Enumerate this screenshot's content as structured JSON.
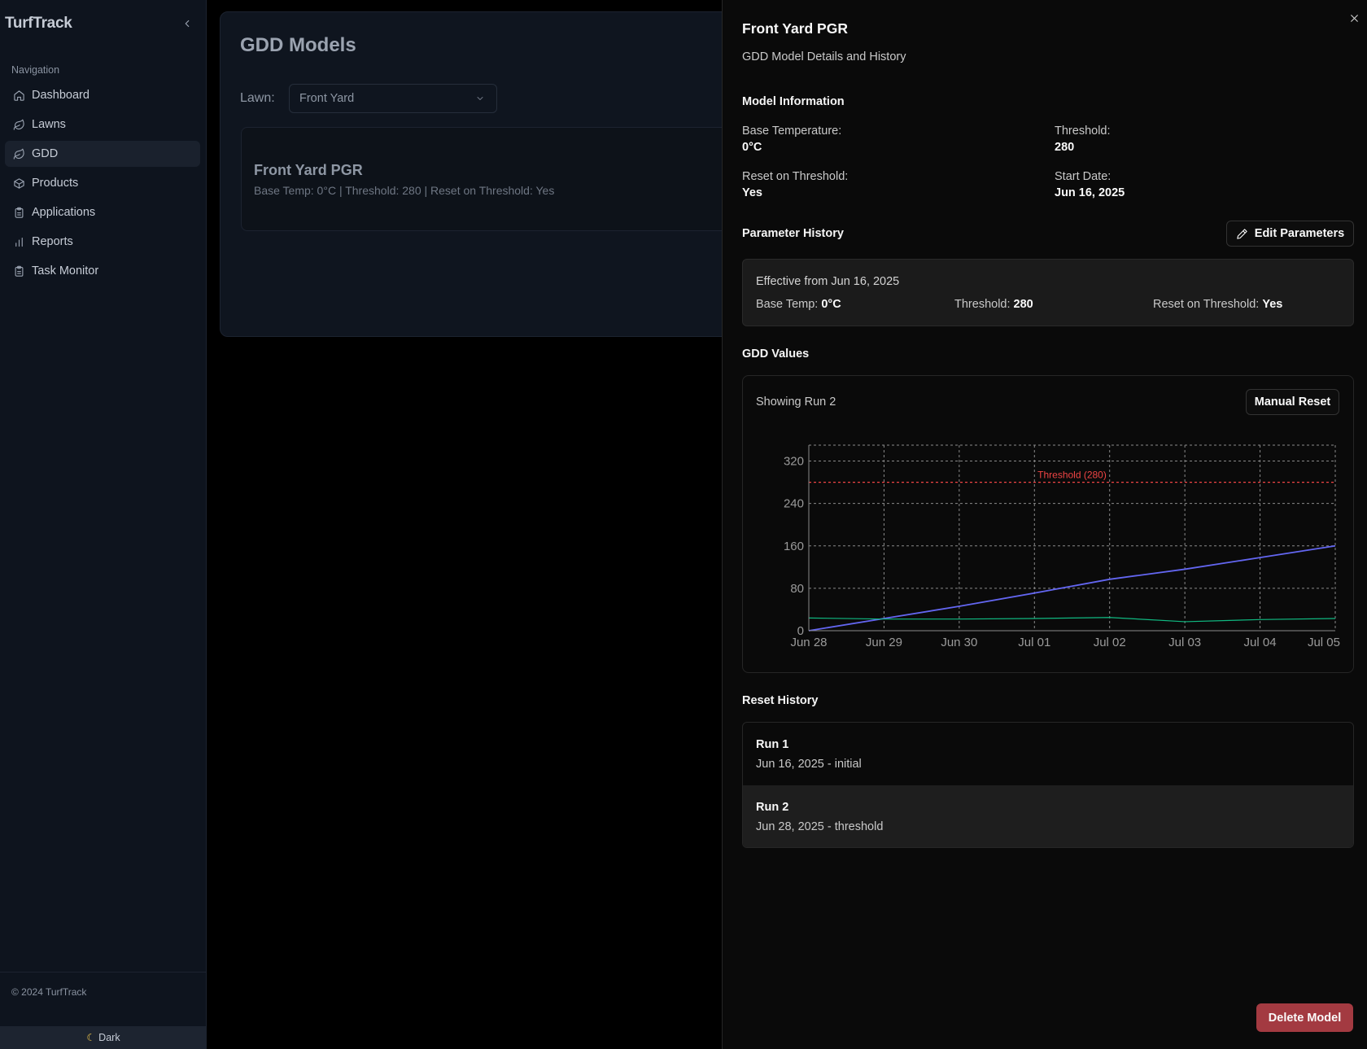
{
  "sidebar": {
    "brand": "TurfTrack",
    "nav_heading": "Navigation",
    "items": [
      {
        "label": "Dashboard",
        "icon": "home-icon"
      },
      {
        "label": "Lawns",
        "icon": "leaf-icon"
      },
      {
        "label": "GDD",
        "icon": "leaf-icon",
        "active": true
      },
      {
        "label": "Products",
        "icon": "package-icon"
      },
      {
        "label": "Applications",
        "icon": "clipboard-icon"
      },
      {
        "label": "Reports",
        "icon": "bar-chart-icon"
      },
      {
        "label": "Task Monitor",
        "icon": "clipboard-icon"
      }
    ],
    "copyright": "© 2024 TurfTrack",
    "theme_toggle": "Dark"
  },
  "main": {
    "title": "GDD Models",
    "lawn_label": "Lawn:",
    "lawn_selected": "Front Yard",
    "model_card": {
      "name": "Front Yard PGR",
      "summary": "Base Temp: 0°C | Threshold: 280 | Reset on Threshold: Yes"
    }
  },
  "drawer": {
    "title": "Front Yard PGR",
    "subtitle": "GDD Model Details and History",
    "model_info": {
      "heading": "Model Information",
      "base_temp_label": "Base Temperature:",
      "base_temp_value": "0°C",
      "threshold_label": "Threshold:",
      "threshold_value": "280",
      "reset_label": "Reset on Threshold:",
      "reset_value": "Yes",
      "start_label": "Start Date:",
      "start_value": "Jun 16, 2025"
    },
    "param_history": {
      "heading": "Parameter History",
      "edit_button": "Edit Parameters",
      "effective": "Effective from Jun 16, 2025",
      "base_temp_label": "Base Temp:",
      "base_temp_value": "0°C",
      "threshold_label": "Threshold:",
      "threshold_value": "280",
      "reset_label": "Reset on Threshold:",
      "reset_value": "Yes"
    },
    "gdd_values": {
      "heading": "GDD Values",
      "showing": "Showing Run 2",
      "manual_reset_button": "Manual Reset"
    },
    "reset_history": {
      "heading": "Reset History",
      "runs": [
        {
          "run": "Run 1",
          "detail": "Jun 16, 2025 - initial"
        },
        {
          "run": "Run 2",
          "detail": "Jun 28, 2025 - threshold",
          "selected": true
        }
      ]
    },
    "delete_button": "Delete Model"
  },
  "colors": {
    "cumulative_line": "#6366f1",
    "daily_line": "#10b981",
    "threshold_line": "#ef4444",
    "delete_button": "#a33a41"
  },
  "chart_data": {
    "type": "line",
    "x": [
      "Jun 28",
      "Jun 29",
      "Jun 30",
      "Jul 01",
      "Jul 02",
      "Jul 03",
      "Jul 04",
      "Jul 05"
    ],
    "series": [
      {
        "values": [
          0,
          23,
          46,
          71,
          97,
          116,
          138,
          160
        ],
        "color": "#6366f1"
      },
      {
        "values": [
          24,
          22,
          22,
          23,
          25,
          17,
          21,
          23
        ],
        "color": "#10b981"
      }
    ],
    "threshold": {
      "value": 280,
      "label": "Threshold (280)"
    },
    "yticks": [
      0,
      80,
      160,
      240,
      320
    ],
    "ylim": [
      0,
      350
    ],
    "grid": true
  }
}
